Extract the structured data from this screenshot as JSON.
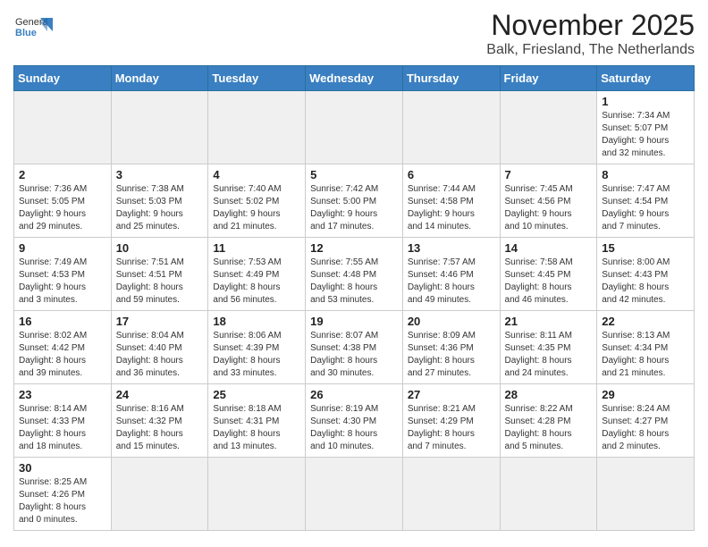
{
  "logo": {
    "text_normal": "General",
    "text_bold": "Blue"
  },
  "title": "November 2025",
  "subtitle": "Balk, Friesland, The Netherlands",
  "weekdays": [
    "Sunday",
    "Monday",
    "Tuesday",
    "Wednesday",
    "Thursday",
    "Friday",
    "Saturday"
  ],
  "weeks": [
    [
      {
        "day": "",
        "info": "",
        "empty": true
      },
      {
        "day": "",
        "info": "",
        "empty": true
      },
      {
        "day": "",
        "info": "",
        "empty": true
      },
      {
        "day": "",
        "info": "",
        "empty": true
      },
      {
        "day": "",
        "info": "",
        "empty": true
      },
      {
        "day": "",
        "info": "",
        "empty": true
      },
      {
        "day": "1",
        "info": "Sunrise: 7:34 AM\nSunset: 5:07 PM\nDaylight: 9 hours\nand 32 minutes.",
        "empty": false
      }
    ],
    [
      {
        "day": "2",
        "info": "Sunrise: 7:36 AM\nSunset: 5:05 PM\nDaylight: 9 hours\nand 29 minutes.",
        "empty": false
      },
      {
        "day": "3",
        "info": "Sunrise: 7:38 AM\nSunset: 5:03 PM\nDaylight: 9 hours\nand 25 minutes.",
        "empty": false
      },
      {
        "day": "4",
        "info": "Sunrise: 7:40 AM\nSunset: 5:02 PM\nDaylight: 9 hours\nand 21 minutes.",
        "empty": false
      },
      {
        "day": "5",
        "info": "Sunrise: 7:42 AM\nSunset: 5:00 PM\nDaylight: 9 hours\nand 17 minutes.",
        "empty": false
      },
      {
        "day": "6",
        "info": "Sunrise: 7:44 AM\nSunset: 4:58 PM\nDaylight: 9 hours\nand 14 minutes.",
        "empty": false
      },
      {
        "day": "7",
        "info": "Sunrise: 7:45 AM\nSunset: 4:56 PM\nDaylight: 9 hours\nand 10 minutes.",
        "empty": false
      },
      {
        "day": "8",
        "info": "Sunrise: 7:47 AM\nSunset: 4:54 PM\nDaylight: 9 hours\nand 7 minutes.",
        "empty": false
      }
    ],
    [
      {
        "day": "9",
        "info": "Sunrise: 7:49 AM\nSunset: 4:53 PM\nDaylight: 9 hours\nand 3 minutes.",
        "empty": false
      },
      {
        "day": "10",
        "info": "Sunrise: 7:51 AM\nSunset: 4:51 PM\nDaylight: 8 hours\nand 59 minutes.",
        "empty": false
      },
      {
        "day": "11",
        "info": "Sunrise: 7:53 AM\nSunset: 4:49 PM\nDaylight: 8 hours\nand 56 minutes.",
        "empty": false
      },
      {
        "day": "12",
        "info": "Sunrise: 7:55 AM\nSunset: 4:48 PM\nDaylight: 8 hours\nand 53 minutes.",
        "empty": false
      },
      {
        "day": "13",
        "info": "Sunrise: 7:57 AM\nSunset: 4:46 PM\nDaylight: 8 hours\nand 49 minutes.",
        "empty": false
      },
      {
        "day": "14",
        "info": "Sunrise: 7:58 AM\nSunset: 4:45 PM\nDaylight: 8 hours\nand 46 minutes.",
        "empty": false
      },
      {
        "day": "15",
        "info": "Sunrise: 8:00 AM\nSunset: 4:43 PM\nDaylight: 8 hours\nand 42 minutes.",
        "empty": false
      }
    ],
    [
      {
        "day": "16",
        "info": "Sunrise: 8:02 AM\nSunset: 4:42 PM\nDaylight: 8 hours\nand 39 minutes.",
        "empty": false
      },
      {
        "day": "17",
        "info": "Sunrise: 8:04 AM\nSunset: 4:40 PM\nDaylight: 8 hours\nand 36 minutes.",
        "empty": false
      },
      {
        "day": "18",
        "info": "Sunrise: 8:06 AM\nSunset: 4:39 PM\nDaylight: 8 hours\nand 33 minutes.",
        "empty": false
      },
      {
        "day": "19",
        "info": "Sunrise: 8:07 AM\nSunset: 4:38 PM\nDaylight: 8 hours\nand 30 minutes.",
        "empty": false
      },
      {
        "day": "20",
        "info": "Sunrise: 8:09 AM\nSunset: 4:36 PM\nDaylight: 8 hours\nand 27 minutes.",
        "empty": false
      },
      {
        "day": "21",
        "info": "Sunrise: 8:11 AM\nSunset: 4:35 PM\nDaylight: 8 hours\nand 24 minutes.",
        "empty": false
      },
      {
        "day": "22",
        "info": "Sunrise: 8:13 AM\nSunset: 4:34 PM\nDaylight: 8 hours\nand 21 minutes.",
        "empty": false
      }
    ],
    [
      {
        "day": "23",
        "info": "Sunrise: 8:14 AM\nSunset: 4:33 PM\nDaylight: 8 hours\nand 18 minutes.",
        "empty": false
      },
      {
        "day": "24",
        "info": "Sunrise: 8:16 AM\nSunset: 4:32 PM\nDaylight: 8 hours\nand 15 minutes.",
        "empty": false
      },
      {
        "day": "25",
        "info": "Sunrise: 8:18 AM\nSunset: 4:31 PM\nDaylight: 8 hours\nand 13 minutes.",
        "empty": false
      },
      {
        "day": "26",
        "info": "Sunrise: 8:19 AM\nSunset: 4:30 PM\nDaylight: 8 hours\nand 10 minutes.",
        "empty": false
      },
      {
        "day": "27",
        "info": "Sunrise: 8:21 AM\nSunset: 4:29 PM\nDaylight: 8 hours\nand 7 minutes.",
        "empty": false
      },
      {
        "day": "28",
        "info": "Sunrise: 8:22 AM\nSunset: 4:28 PM\nDaylight: 8 hours\nand 5 minutes.",
        "empty": false
      },
      {
        "day": "29",
        "info": "Sunrise: 8:24 AM\nSunset: 4:27 PM\nDaylight: 8 hours\nand 2 minutes.",
        "empty": false
      }
    ],
    [
      {
        "day": "30",
        "info": "Sunrise: 8:25 AM\nSunset: 4:26 PM\nDaylight: 8 hours\nand 0 minutes.",
        "empty": false
      },
      {
        "day": "",
        "info": "",
        "empty": true
      },
      {
        "day": "",
        "info": "",
        "empty": true
      },
      {
        "day": "",
        "info": "",
        "empty": true
      },
      {
        "day": "",
        "info": "",
        "empty": true
      },
      {
        "day": "",
        "info": "",
        "empty": true
      },
      {
        "day": "",
        "info": "",
        "empty": true
      }
    ]
  ]
}
